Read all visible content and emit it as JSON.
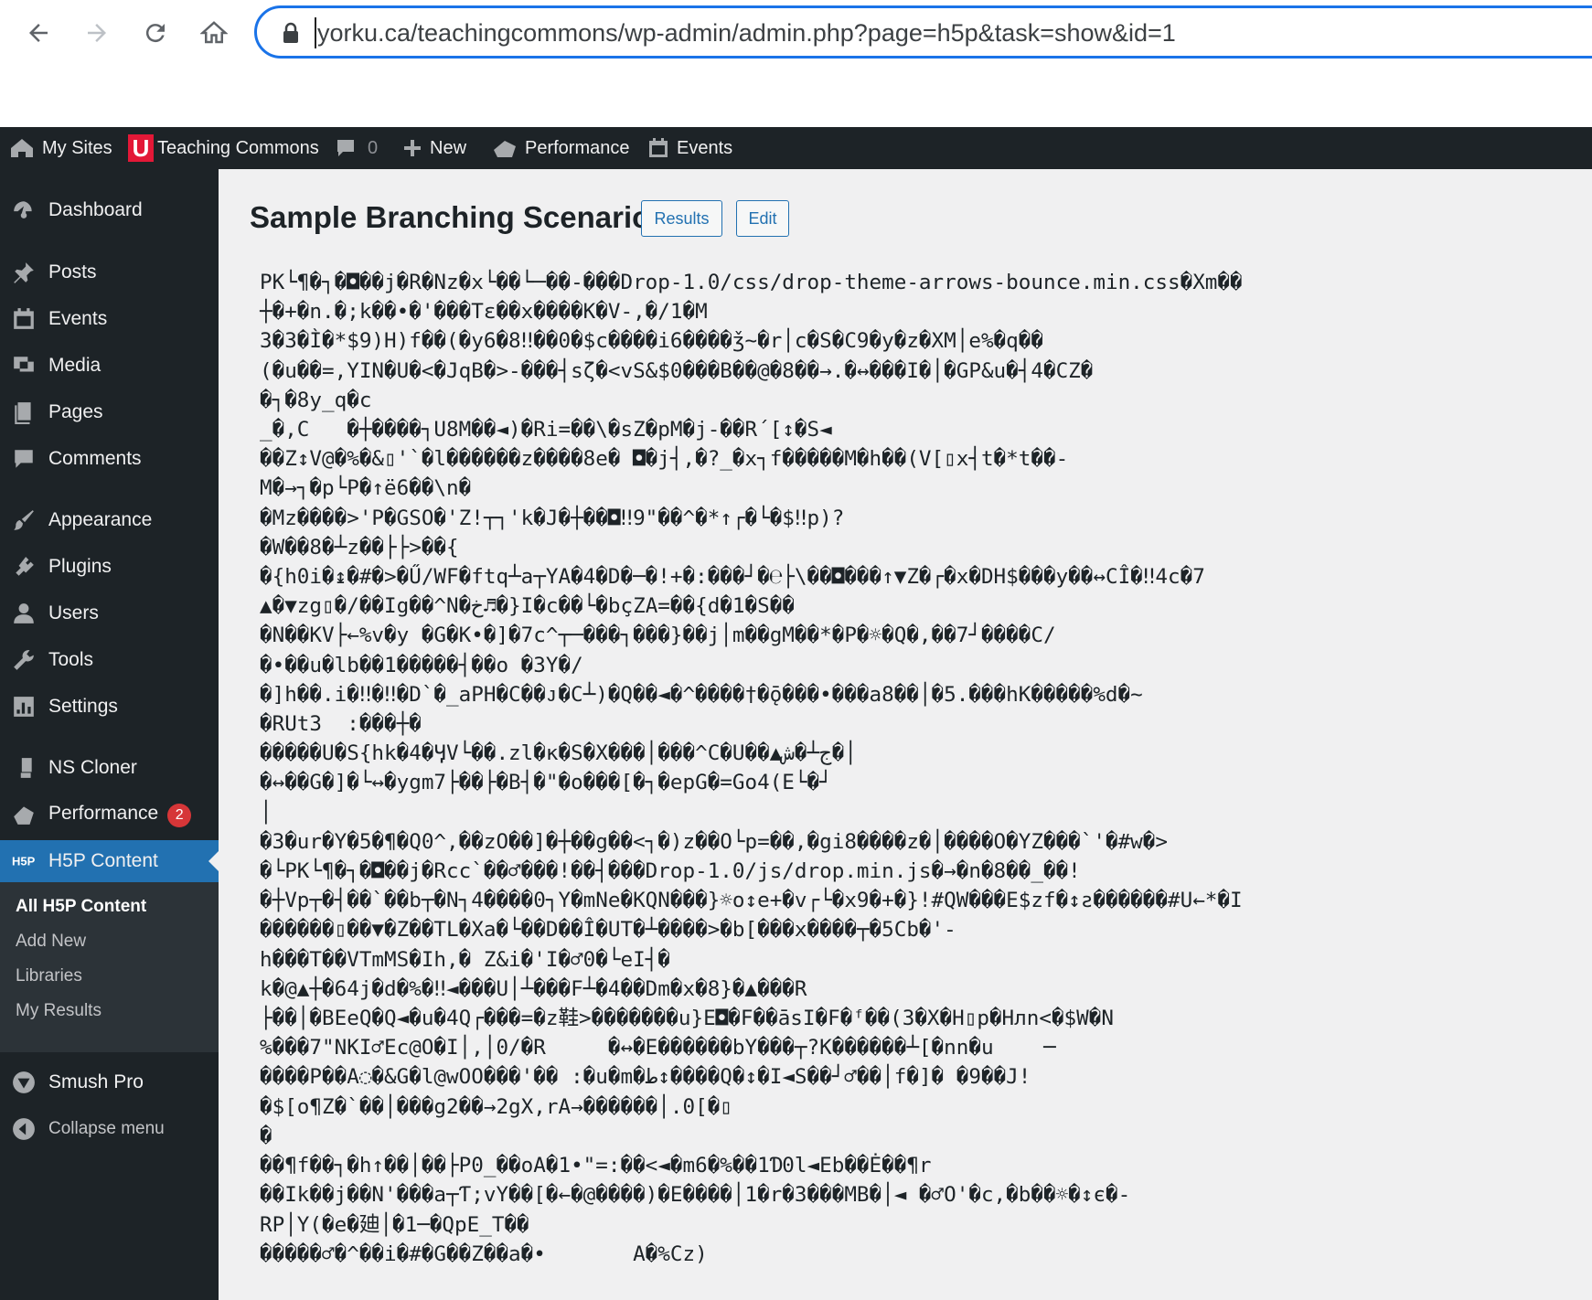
{
  "browser": {
    "url": "yorku.ca/teachingcommons/wp-admin/admin.php?page=h5p&task=show&id=1"
  },
  "admin_bar": {
    "my_sites": "My Sites",
    "site_name": "Teaching Commons",
    "site_logo_letter": "U",
    "comments_count": "0",
    "new_label": "New",
    "performance_label": "Performance",
    "events_label": "Events"
  },
  "sidebar": {
    "items": [
      {
        "label": "Dashboard",
        "icon": "dashboard-icon"
      },
      {
        "label": "Posts",
        "icon": "pin-icon"
      },
      {
        "label": "Events",
        "icon": "calendar-icon"
      },
      {
        "label": "Media",
        "icon": "media-icon"
      },
      {
        "label": "Pages",
        "icon": "pages-icon"
      },
      {
        "label": "Comments",
        "icon": "comment-icon"
      },
      {
        "label": "Appearance",
        "icon": "brush-icon"
      },
      {
        "label": "Plugins",
        "icon": "plugin-icon"
      },
      {
        "label": "Users",
        "icon": "user-icon"
      },
      {
        "label": "Tools",
        "icon": "wrench-icon"
      },
      {
        "label": "Settings",
        "icon": "settings-icon"
      },
      {
        "label": "NS Cloner",
        "icon": "cloner-icon"
      },
      {
        "label": "Performance",
        "icon": "performance-icon",
        "badge": "2"
      },
      {
        "label": "H5P Content",
        "icon": "h5p-icon"
      },
      {
        "label": "Smush Pro",
        "icon": "smush-icon"
      },
      {
        "label": "Collapse menu",
        "icon": "collapse-icon"
      }
    ],
    "submenu": [
      {
        "label": "All H5P Content"
      },
      {
        "label": "Add New"
      },
      {
        "label": "Libraries"
      },
      {
        "label": "My Results"
      }
    ]
  },
  "main": {
    "title": "Sample Branching Scenario",
    "results_button": "Results",
    "edit_button": "Edit",
    "raw_lines": [
      "PK└¶�┐�◘��j�R�Nz�x└��└─��-���Drop-1.0/css/drop-theme-arrows-bounce.min.css�Xm��",
      "┼�+�n.�;k��•�'���Tɛ��x����K�V-,�/1�M",
      "3�3�Ì�*$9)H)f��(�y6�8‼��0�$c����i6����ǯ~�r│c�S�C9�y�z�XM│e%�q��",
      "(�u��=,YIN�U�<�JqB�>-���┤sζ�<vS&$0���B��@�8��→.�↔���I�│�GP&u�┤4�CZ�",
      "�┐�8y_q�c",
      "_�,C   �┼����┐U8M��◄)�Ri=��\\�sZ�pM�j-��R´[↕�S◄",
      "��Z↕V@�%�&▯'`�l������z����8e� ◘�j┤,�?_�x┐f�����M�h��(V[▯x┤t�*t��-",
      "M�→┐�p└P�↑ë6��\\n�",
      "�Mz����>'P�GSO�'Z!┬┐'k�J�┼��◘‼9\"��^�*↑┌�└�$‼p)?",
      "�W��8�┴z��├├>��{",
      "�{h0i�↨�#�>�Ű/WF�ftq┴a┬YA�4�D�─�!+�:���┘�℮├\\��◘���↑▼Z�┌�x�DH$���y��↔CÎ�‼4c�7",
      "▲�▼zg▯�/��Ig��^N�خ♬�}I�c��└�bçZA=��{d�1�S��",
      "�N��KV├←%v�y �G�K•�]�7c^┬─���┐���}��j│m��gM��*�P�☼�Q�,��7┘����C/",
      "�•��u�lb��1�����┤��o �3Y�/",
      "�]h��.i�‼�‼�D`�_aPH�C��ᴊ�C┴)�Q��◄�^����†�ǭ���•���a8��│�5.���hK�����%d�~",
      "�RUt3  :���┼�",
      "�����U�S{hk�4�ӋV└��.zl�ĸ�S�X���│���^C�U��▲ج┴�ش�│",
      "�↔��G�]�└↔�ygm7├��├�B┤�\"�o���[�┐�epG�=Go4(E└�┘",
      "│",
      "�3�ur�Y�5�¶�Q0^,��zO��]�┼��g��<┐�)z��O└p=��,�gi8����z�│����O�YZ���`'�#w�>",
      "�└PK└¶�┐�◘��j�Rcc`��♂���!��┤���Drop-1.0/js/drop.min.js�→�n�8��_��!",
      "�┼Vp┬�┤��`��b┬�N┐4����0┐Y�mNe�KQN���}☼o↕e+�v┌└�x9�+�}!#QW���E$zf�↕ƨ������#U←*�I",
      "������▯��▼�Z��TL�Xa�└��D��Î�UT�┴����>�b[���x����┬�5Cb�'-",
      "h���T��VTmMS�Ih,� Z&i�'I�♂0�└eI┤�",
      "k�@▲┼�64j�d�%�‼◄���U│┴���F┴�4��Dm�x�8}�▲���R",
      "├��│�BEeQ�Q◄�u�4Q┌���=�z鞋>�������u}E◘�F��āsI�F�ᶠ��(3�X�H▯p�Hлn<�$W�N",
      "%���7\"NKI♂Ec@O�I│,│0/�R     �↔�E������bY���┬?K������┴[�nn�u    ─",
      "����P��A◌�&G�l@wOO���'�� :�u�m�ط↕����Q�↕�I◄S��┘♂��│f�]� �9��J!",
      "�$[o¶Z�`��│���g2��→2gX,rA→������│.0[�▯",
      "�",
      "��¶f��┐�h↑��│��├P0_��oA�1•\"=:��<◄�m6�%��1Ɗ0l◄Eb��Ė��¶r",
      "��Ik��j��N'���a┬Ƭ;vY��[�←�@����)�E����│1�r�3���MB�│◄ �♂O'�c,�b��☼�↕є�-",
      "RP│Y(�e�廸│�1─�QpE_T��",
      "�����♂�^��i�#�G��Z��a�•       A�%Cz)"
    ]
  },
  "colors": {
    "admin_bar_bg": "#1d2327",
    "sidebar_bg": "#1d2327",
    "active_menu_bg": "#2271b1",
    "content_bg": "#f0f0f1",
    "url_border": "#1a73e8",
    "badge_bg": "#d63638",
    "site_logo_bg": "#e31837"
  }
}
